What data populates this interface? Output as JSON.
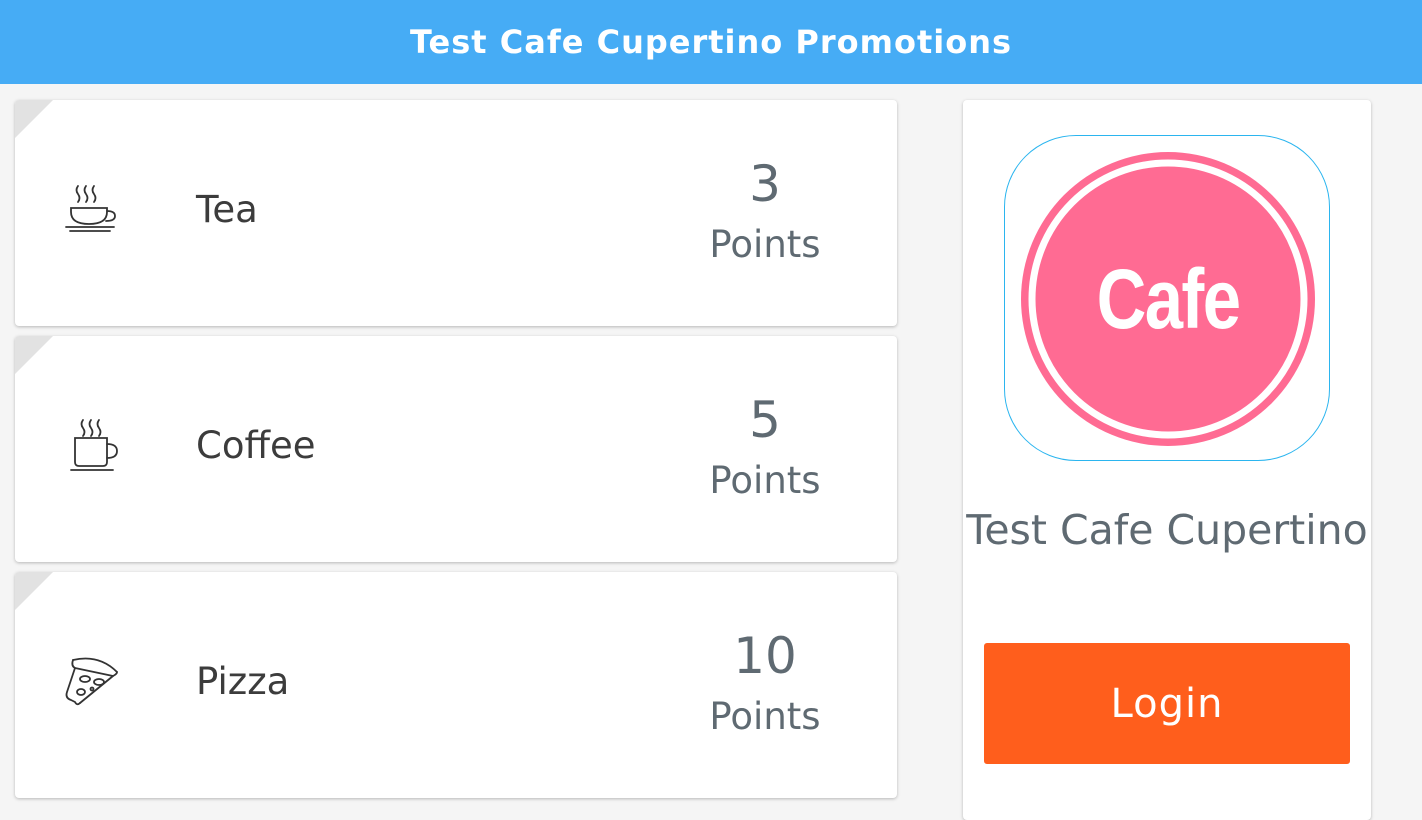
{
  "header": {
    "title": "Test Cafe Cupertino Promotions"
  },
  "promotions": [
    {
      "name": "Tea",
      "points": "3",
      "points_label": "Points",
      "icon": "tea-cup-icon"
    },
    {
      "name": "Coffee",
      "points": "5",
      "points_label": "Points",
      "icon": "coffee-mug-icon"
    },
    {
      "name": "Pizza",
      "points": "10",
      "points_label": "Points",
      "icon": "pizza-slice-icon"
    }
  ],
  "cafe": {
    "logo_text": "Cafe",
    "name": "Test Cafe Cupertino",
    "login_label": "Login"
  },
  "colors": {
    "header_bg": "#46acf5",
    "logo_pink": "#ff6b93",
    "login_bg": "#ff5e1c",
    "text_gray": "#5f6a72"
  }
}
